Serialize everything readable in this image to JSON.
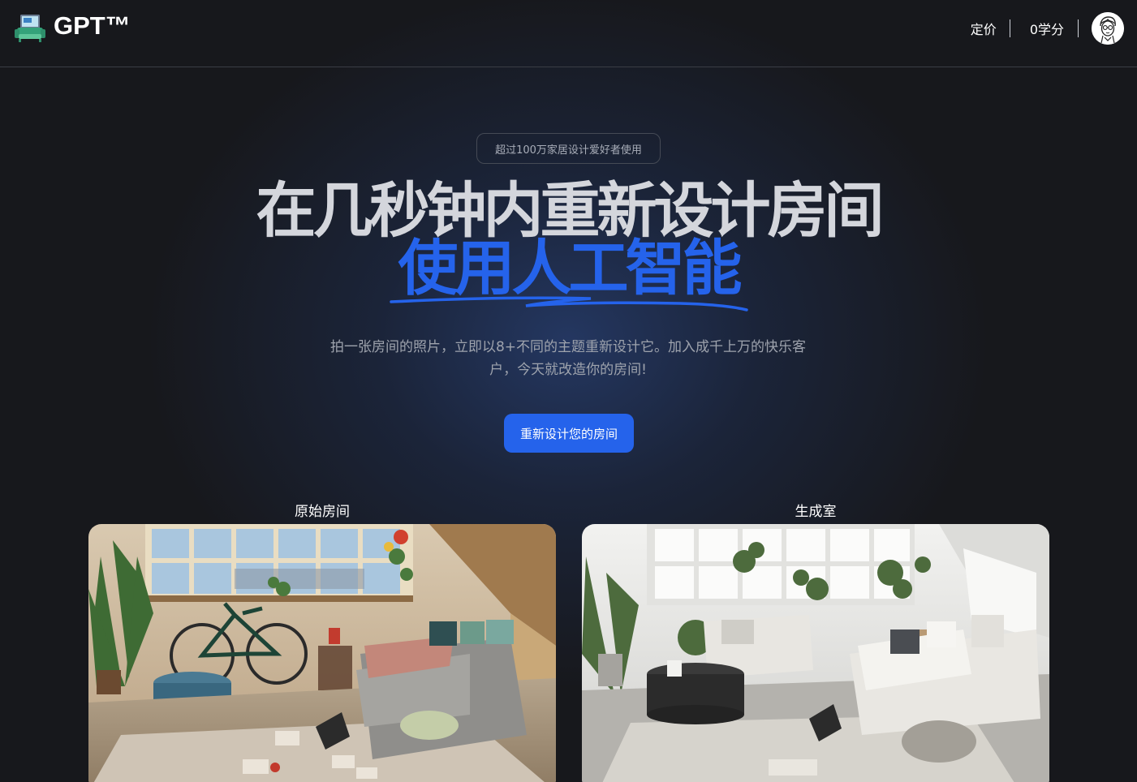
{
  "header": {
    "brand": {
      "name": "GPT™",
      "icon": "sofa-icon"
    },
    "nav": {
      "pricing_label": "定价",
      "credits_label": "0学分",
      "avatar_icon": "user-avatar-sketch"
    }
  },
  "hero": {
    "badge": "超过100万家居设计爱好者使用",
    "title_line1": "在几秒钟内重新设计房间",
    "title_line2": "使用人工智能",
    "subtitle": "拍一张房间的照片，立即以8+不同的主题重新设计它。加入成千上万的快乐客户，今天就改造你的房间!",
    "cta_label": "重新设计您的房间"
  },
  "comparison": {
    "original_label": "原始房间",
    "generated_label": "生成室"
  },
  "colors": {
    "accent": "#2563eb",
    "background": "#17181c",
    "title": "#d4d6dc",
    "muted": "#9ea3ad"
  }
}
